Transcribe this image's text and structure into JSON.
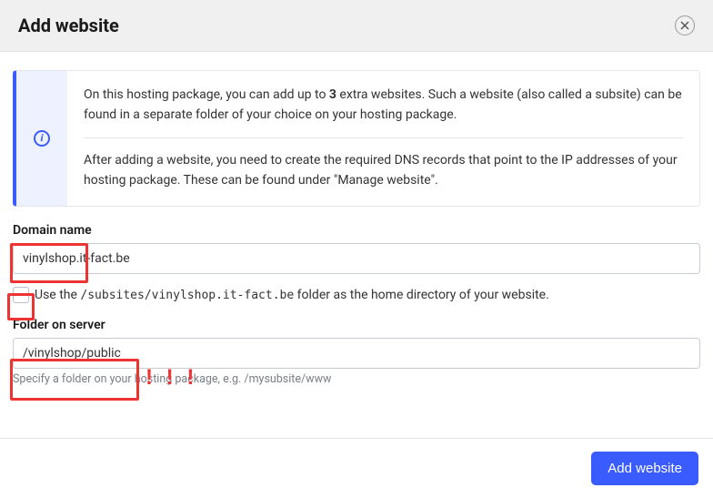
{
  "header": {
    "title": "Add website"
  },
  "info": {
    "para1_prefix": "On this hosting package, you can add up to ",
    "para1_bold": "3",
    "para1_suffix": " extra websites. Such a website (also called a subsite) can be found in a separate folder of your choice on your hosting package.",
    "para2": "After adding a website, you need to create the required DNS records that point to the IP addresses of your hosting package. These can be found under \"Manage website\"."
  },
  "domain": {
    "label": "Domain name",
    "value": "vinylshop.it-fact.be"
  },
  "checkbox": {
    "prefix": "Use the ",
    "path": "/subsites/vinylshop.it-fact.be",
    "suffix": " folder as the home directory of your website."
  },
  "folder": {
    "label": "Folder on server",
    "value": "/vinylshop/public",
    "helper": "Specify a folder on your hosting package, e.g. /mysubsite/www"
  },
  "footer": {
    "submit": "Add website"
  },
  "annotation": {
    "exclaim": "! ! !"
  }
}
